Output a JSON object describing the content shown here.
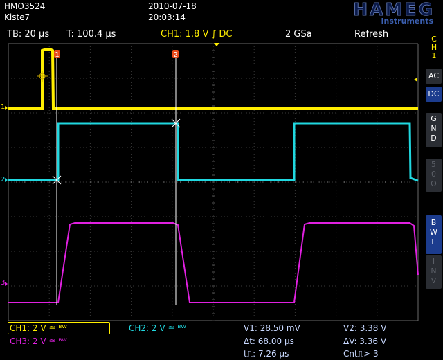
{
  "header": {
    "model": "HMO3524",
    "name": "Kiste7",
    "date": "2010-07-18",
    "time": "20:03:14",
    "brand": "HAMEG",
    "brand_sub": "Instruments"
  },
  "status": {
    "timebase": "TB: 20 µs",
    "trigger_time": "T: 100.4 µs",
    "ch1_trigger": "CH1: 1.8 V ∫ DC",
    "sample_rate": "2 GSa",
    "mode": "Refresh"
  },
  "side_panel": {
    "channel_label": [
      "C",
      "H",
      "1"
    ],
    "ac": "AC",
    "dc": "DC",
    "gnd": [
      "G",
      "N",
      "D"
    ],
    "fifty": [
      "5",
      "0",
      "Ω"
    ],
    "bwl": [
      "B",
      "W",
      "L"
    ],
    "inv": [
      "I",
      "N",
      "V"
    ]
  },
  "markers": {
    "cursor1": "1",
    "cursor2": "2",
    "ch1": "1",
    "ch2": "2",
    "ch3": "3"
  },
  "footer": {
    "ch1": "CH1: 2 V ≅ ᴮᵂ",
    "ch2": "CH2: 2 V ≅ ᴮᵂ",
    "ch3": "CH3: 2 V ≅ ᴮᵂ",
    "v1": "V1: 28.50 mV",
    "v2": "V2: 3.38 V",
    "dt": "Δt: 68.00 µs",
    "dv": "ΔV: 3.36 V",
    "tpulse": "t⎍: 7.26 µs",
    "count": "Cnt⎍> 3"
  },
  "colors": {
    "ch1": "#ffee00",
    "ch2": "#20d8e0",
    "ch3": "#e020e0",
    "grid": "#3a3a3a",
    "accent": "#1c3c8e"
  }
}
